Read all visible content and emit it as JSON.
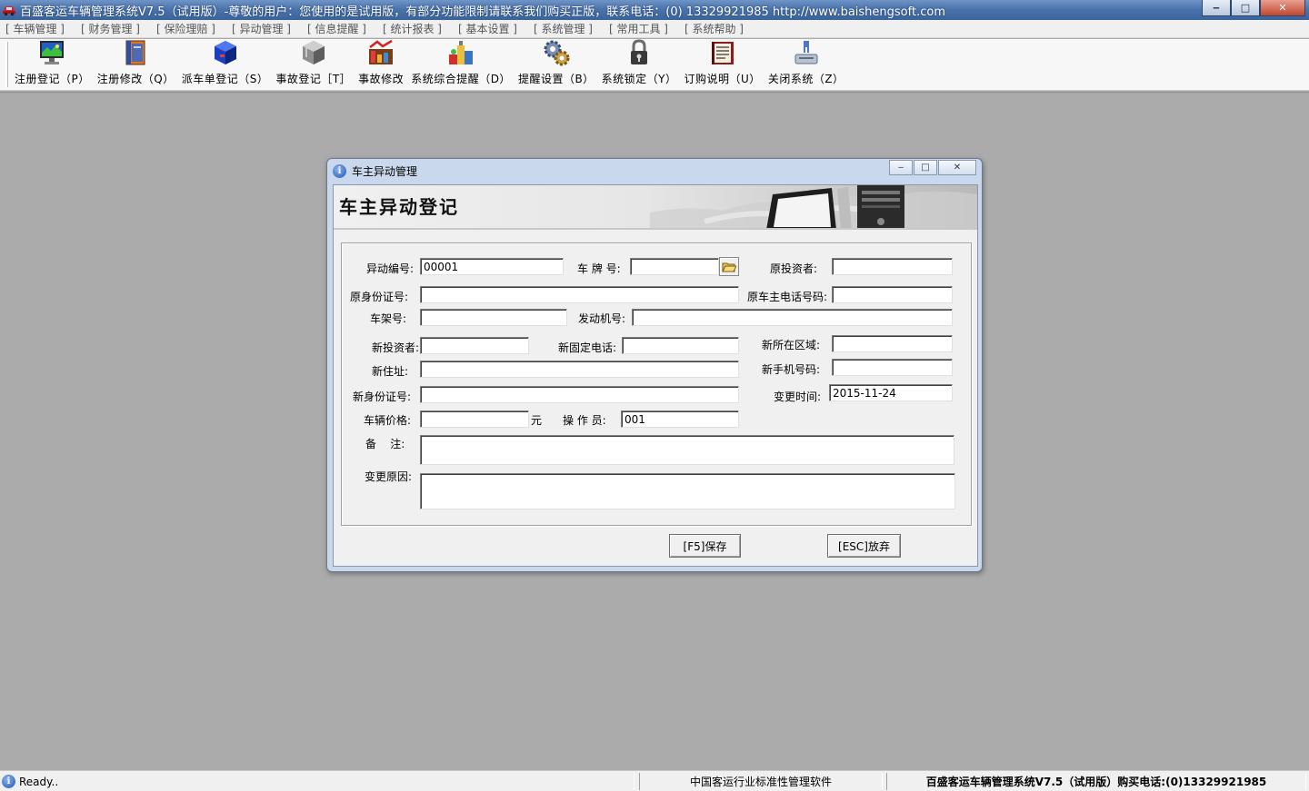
{
  "window": {
    "title": "百盛客运车辆管理系统V7.5（试用版）-尊敬的用户：您使用的是试用版，有部分功能限制请联系我们购买正版，联系电话：(0) 13329921985  http://www.baishengsoft.com",
    "minimize": "‒",
    "maximize": "□",
    "close": "✕"
  },
  "menu": [
    "[ 车辆管理 ]",
    "[ 财务管理 ]",
    "[ 保险理赔 ]",
    "[ 异动管理 ]",
    "[ 信息提醒 ]",
    "[ 统计报表 ]",
    "[ 基本设置 ]",
    "[ 系统管理 ]",
    "[ 常用工具 ]",
    "[ 系统帮助 ]"
  ],
  "toolbar": [
    {
      "label": "注册登记（P）",
      "icon": "monitor-icon"
    },
    {
      "label": "注册修改（Q）",
      "icon": "book-icon"
    },
    {
      "label": "派车单登记（S）",
      "icon": "blue-box-icon"
    },
    {
      "label": "事故登记［T］",
      "icon": "gray-box-icon"
    },
    {
      "label": "事故修改",
      "icon": "chart-icon"
    },
    {
      "label": "系统综合提醒（D）",
      "icon": "bottles-icon"
    },
    {
      "label": "提醒设置（B）",
      "icon": "gears-icon"
    },
    {
      "label": "系统锁定（Y）",
      "icon": "lock-icon"
    },
    {
      "label": "订购说明（U）",
      "icon": "manual-icon"
    },
    {
      "label": "关闭系统（Z）",
      "icon": "shutdown-icon"
    }
  ],
  "dialog": {
    "title": "车主异动管理",
    "banner_title": "车主异动登记",
    "fields": {
      "change_no_label": "异动编号:",
      "change_no_value": "00001",
      "plate_label": "车 牌 号:",
      "plate_value": "",
      "orig_investor_label": "原投资者:",
      "orig_investor_value": "",
      "orig_id_label": "原身份证号:",
      "orig_id_value": "",
      "orig_phone_label": "原车主电话号码:",
      "orig_phone_value": "",
      "frame_label": "车架号:",
      "frame_value": "",
      "engine_label": "发动机号:",
      "engine_value": "",
      "new_investor_label": "新投资者:",
      "new_investor_value": "",
      "new_fixed_phone_label": "新固定电话:",
      "new_fixed_phone_value": "",
      "new_region_label": "新所在区域:",
      "new_region_value": "",
      "new_address_label": "新住址:",
      "new_address_value": "",
      "new_mobile_label": "新手机号码:",
      "new_mobile_value": "",
      "new_id_label": "新身份证号:",
      "new_id_value": "",
      "change_time_label": "变更时间:",
      "change_time_value": "2015-11-24",
      "price_label": "车辆价格:",
      "price_value": "",
      "price_unit": "元",
      "operator_label": "操 作 员:",
      "operator_value": "001",
      "remark_label": "备    注:",
      "remark_value": "",
      "reason_label": "变更原因:",
      "reason_value": ""
    },
    "save_button": "[F5]保存",
    "cancel_button": "[ESC]放弃"
  },
  "statusbar": {
    "ready": "Ready..",
    "middle": "中国客运行业标准性管理软件",
    "right": "百盛客运车辆管理系统V7.5（试用版）购买电话:(0)13329921985"
  }
}
